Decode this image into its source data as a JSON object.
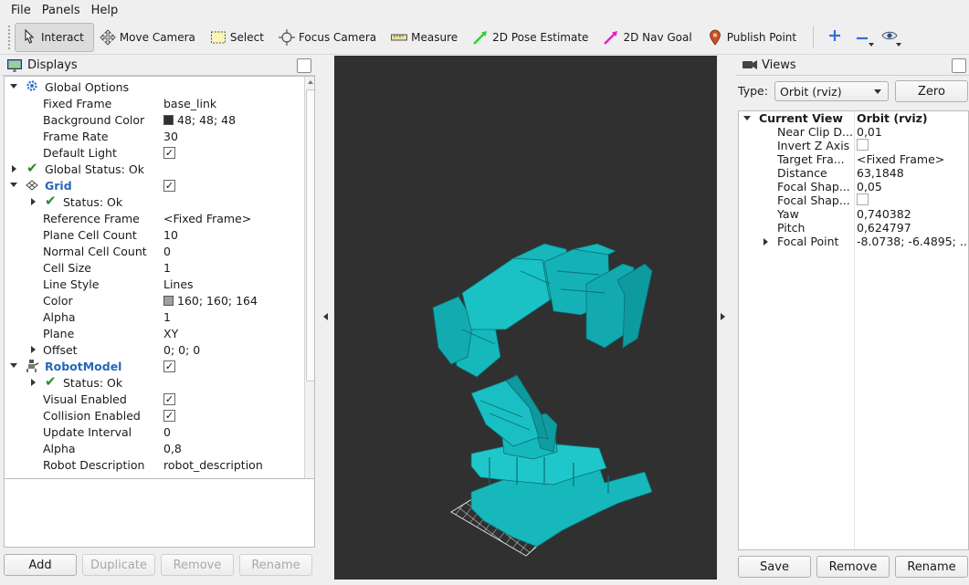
{
  "menu": {
    "file": "File",
    "panels": "Panels",
    "help": "Help"
  },
  "toolbar": {
    "interact": "Interact",
    "move_camera": "Move Camera",
    "select": "Select",
    "focus_camera": "Focus Camera",
    "measure": "Measure",
    "pose_estimate": "2D Pose Estimate",
    "nav_goal": "2D Nav Goal",
    "publish_point": "Publish Point"
  },
  "displays": {
    "title": "Displays",
    "rows": [
      {
        "name": "Global Options",
        "value": ""
      },
      {
        "name": "Fixed Frame",
        "value": "base_link"
      },
      {
        "name": "Background Color",
        "value": "48; 48; 48",
        "color": "#303030"
      },
      {
        "name": "Frame Rate",
        "value": "30"
      },
      {
        "name": "Default Light",
        "value": "",
        "checked": true
      },
      {
        "name": "Global Status: Ok",
        "value": ""
      },
      {
        "name": "Grid",
        "value": "",
        "checked": true
      },
      {
        "name": "Status: Ok",
        "value": ""
      },
      {
        "name": "Reference Frame",
        "value": "<Fixed Frame>"
      },
      {
        "name": "Plane Cell Count",
        "value": "10"
      },
      {
        "name": "Normal Cell Count",
        "value": "0"
      },
      {
        "name": "Cell Size",
        "value": "1"
      },
      {
        "name": "Line Style",
        "value": "Lines"
      },
      {
        "name": "Color",
        "value": "160; 160; 164",
        "color": "#a0a0a4"
      },
      {
        "name": "Alpha",
        "value": "1"
      },
      {
        "name": "Plane",
        "value": "XY"
      },
      {
        "name": "Offset",
        "value": "0; 0; 0"
      },
      {
        "name": "RobotModel",
        "value": "",
        "checked": true
      },
      {
        "name": "Status: Ok",
        "value": ""
      },
      {
        "name": "Visual Enabled",
        "value": "",
        "checked": true
      },
      {
        "name": "Collision Enabled",
        "value": "",
        "checked": true
      },
      {
        "name": "Update Interval",
        "value": "0"
      },
      {
        "name": "Alpha",
        "value": "0,8"
      },
      {
        "name": "Robot Description",
        "value": "robot_description"
      }
    ],
    "buttons": {
      "add": "Add",
      "duplicate": "Duplicate",
      "remove": "Remove",
      "rename": "Rename"
    }
  },
  "views": {
    "title": "Views",
    "type_label": "Type:",
    "type_value": "Orbit (rviz)",
    "zero": "Zero",
    "current_view": {
      "name": "Current View",
      "value": "Orbit (rviz)"
    },
    "rows": [
      {
        "name": "Near Clip D...",
        "value": "0,01"
      },
      {
        "name": "Invert Z Axis",
        "value": "",
        "checked": false
      },
      {
        "name": "Target Fra...",
        "value": "<Fixed Frame>"
      },
      {
        "name": "Distance",
        "value": "63,1848"
      },
      {
        "name": "Focal Shap...",
        "value": "0,05"
      },
      {
        "name": "Focal Shap...",
        "value": "",
        "checked": false
      },
      {
        "name": "Yaw",
        "value": "0,740382"
      },
      {
        "name": "Pitch",
        "value": "0,624797"
      },
      {
        "name": "Focal Point",
        "value": "-8.0738; -6.4895; ..."
      }
    ],
    "buttons": {
      "save": "Save",
      "remove": "Remove",
      "rename": "Rename"
    }
  },
  "viewport": {
    "background": "#303030",
    "robot_color": "#16b8bc",
    "grid_color": "#d6d6d6"
  },
  "icons": {
    "displays": "monitor-icon",
    "global_options": "gear-icon",
    "grid": "grid-icon",
    "robot": "robot-icon",
    "status_ok": "checkmark-icon",
    "views": "camera-icon"
  }
}
